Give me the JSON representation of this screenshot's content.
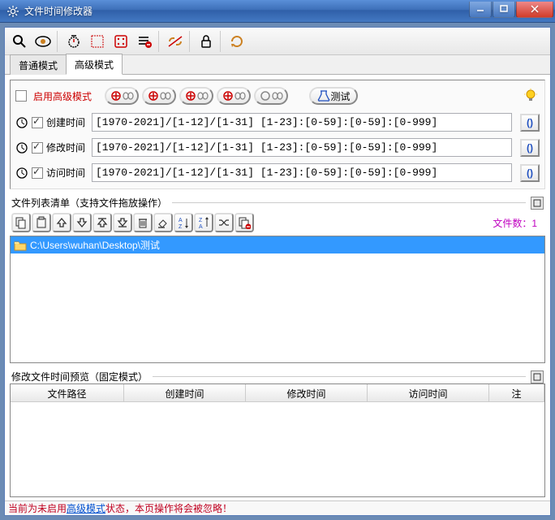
{
  "window": {
    "title": "文件时间修改器"
  },
  "tabs": {
    "normal": "普通模式",
    "advanced": "高级模式"
  },
  "adv": {
    "enable_label": "启用高级模式",
    "test_label": "测试",
    "rows": [
      {
        "label": "创建时间",
        "value": "[1970-2021]/[1-12]/[1-31] [1-23]:[0-59]:[0-59]:[0-999]"
      },
      {
        "label": "修改时间",
        "value": "[1970-2021]/[1-12]/[1-31] [1-23]:[0-59]:[0-59]:[0-999]"
      },
      {
        "label": "访问时间",
        "value": "[1970-2021]/[1-12]/[1-31] [1-23]:[0-59]:[0-59]:[0-999]"
      }
    ]
  },
  "filelist": {
    "title": "文件列表清单（支持文件拖放操作）",
    "count_label": "文件数：1",
    "items": [
      {
        "path": "C:\\Users\\wuhan\\Desktop\\测试"
      }
    ]
  },
  "preview": {
    "title": "修改文件时间预览（固定模式）",
    "cols": {
      "path": "文件路径",
      "ctime": "创建时间",
      "mtime": "修改时间",
      "atime": "访问时间",
      "note": "注"
    }
  },
  "status": {
    "pre": "当前为未启用",
    "link": "高级模式",
    "post": "状态，本页操作将会被忽略！"
  }
}
